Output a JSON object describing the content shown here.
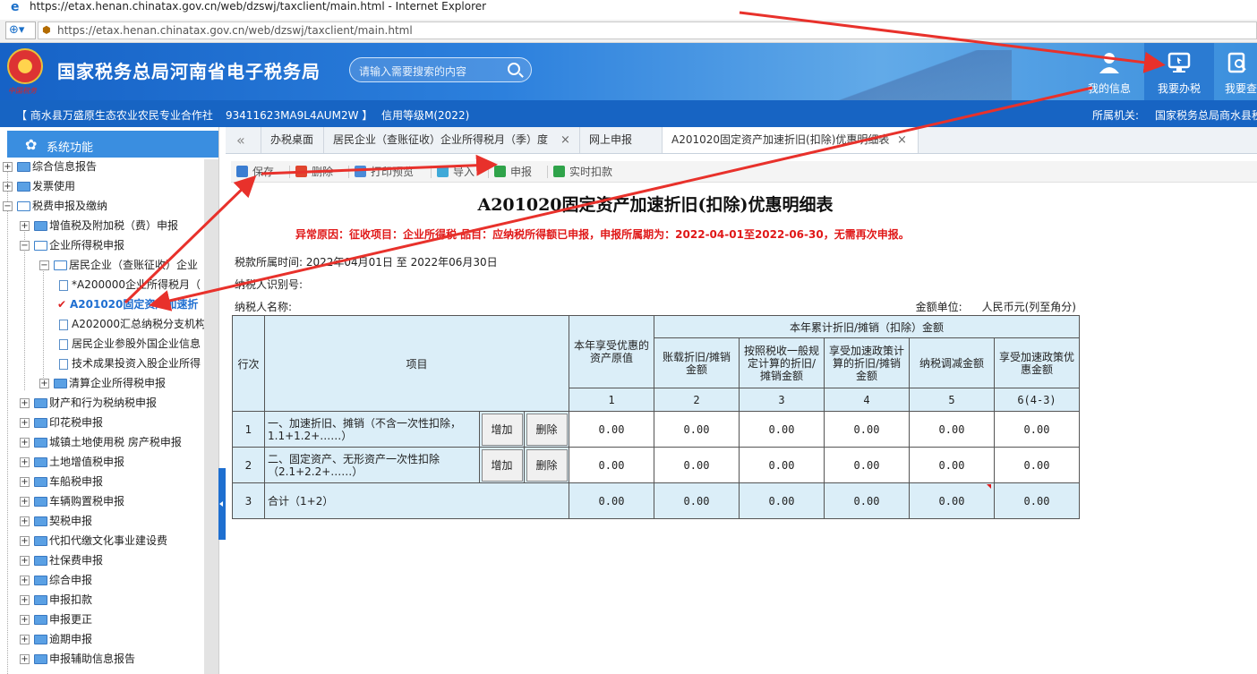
{
  "browser": {
    "window_title": "https://etax.henan.chinatax.gov.cn/web/dzswj/taxclient/main.html - Internet Explorer",
    "address": "https://etax.henan.chinatax.gov.cn/web/dzswj/taxclient/main.html"
  },
  "header": {
    "site_title": "国家税务总局河南省电子税务局",
    "emblem_caption": "中国税务",
    "search_placeholder": "请输入需要搜索的内容",
    "nav": [
      {
        "label": "我的信息",
        "icon": "user-icon"
      },
      {
        "label": "我要办税",
        "icon": "monitor-icon",
        "active": true
      },
      {
        "label": "我要查",
        "icon": "search-doc-icon"
      }
    ]
  },
  "company": {
    "name": "【 商水县万盛原生态农业农民专业合作社",
    "tax_id": "93411623MA9L4AUM2W 】",
    "credit": "信用等级M(2022)",
    "authority_label": "所属机关:",
    "authority": "国家税务总局商水县税"
  },
  "sidebar": {
    "title": "系统功能",
    "items": [
      {
        "label": "综合信息报告"
      },
      {
        "label": "发票使用"
      },
      {
        "label": "税费申报及缴纳"
      },
      {
        "label": "增值税及附加税（费）申报"
      },
      {
        "label": "企业所得税申报"
      },
      {
        "label": "居民企业（查账征收）企业"
      },
      {
        "label": "*A200000企业所得税月（"
      },
      {
        "label": "A201020固定资产加速折"
      },
      {
        "label": "A202000汇总纳税分支机构"
      },
      {
        "label": "居民企业参股外国企业信息"
      },
      {
        "label": "技术成果投资入股企业所得"
      },
      {
        "label": "清算企业所得税申报"
      },
      {
        "label": "财产和行为税纳税申报"
      },
      {
        "label": "印花税申报"
      },
      {
        "label": "城镇土地使用税 房产税申报"
      },
      {
        "label": "土地增值税申报"
      },
      {
        "label": "车船税申报"
      },
      {
        "label": "车辆购置税申报"
      },
      {
        "label": "契税申报"
      },
      {
        "label": "代扣代缴文化事业建设费"
      },
      {
        "label": "社保费申报"
      },
      {
        "label": "综合申报"
      },
      {
        "label": "申报扣款"
      },
      {
        "label": "申报更正"
      },
      {
        "label": "逾期申报"
      },
      {
        "label": "申报辅助信息报告"
      }
    ]
  },
  "tabs": {
    "back": "«",
    "items": [
      {
        "label": "办税桌面",
        "close": ""
      },
      {
        "label": "居民企业（查账征收）企业所得税月（季）度",
        "close": "×"
      },
      {
        "label": "网上申报",
        "close": ""
      },
      {
        "label": "A201020固定资产加速折旧(扣除)优惠明细表",
        "close": "×"
      }
    ]
  },
  "toolbar": {
    "save": "保存",
    "delete": "删除",
    "print": "打印预览",
    "import": "导入",
    "declare": "申报",
    "deduct": "实时扣款"
  },
  "form": {
    "title": "A201020固定资产加速折旧(扣除)优惠明细表",
    "warning": "异常原因：征收项目：企业所得税        品目：应纳税所得额已申报，申报所属期为：2022-04-01至2022-06-30，无需再次申报。",
    "period": "税款所属时间: 2022年04月01日 至 2022年06月30日",
    "taxpayer_id_label": "纳税人识别号:",
    "taxpayer_name_label": "纳税人名称:",
    "unit_label": "金额单位:",
    "unit_value": "人民币元(列至角分)",
    "headers": {
      "row_no": "行次",
      "item": "项目",
      "c1": "本年享受优惠的资产原值",
      "group": "本年累计折旧/摊销（扣除）金额",
      "c2": "账载折旧/摊销金额",
      "c3": "按照税收一般规定计算的折旧/摊销金额",
      "c4": "享受加速政策计算的折旧/摊销金额",
      "c5": "纳税调减金额",
      "c6": "享受加速政策优惠金额",
      "n1": "1",
      "n2": "2",
      "n3": "3",
      "n4": "4",
      "n5": "5",
      "n6": "6(4-3)"
    },
    "add_label": "增加",
    "del_label": "删除",
    "rows": [
      {
        "no": "1",
        "item": "一、加速折旧、摊销（不含一次性扣除，1.1+1.2+……）",
        "v1": "0.00",
        "v2": "0.00",
        "v3": "0.00",
        "v4": "0.00",
        "v5": "0.00",
        "v6": "0.00"
      },
      {
        "no": "2",
        "item": "二、固定资产、无形资产一次性扣除（2.1+2.2+……）",
        "v1": "0.00",
        "v2": "0.00",
        "v3": "0.00",
        "v4": "0.00",
        "v5": "0.00",
        "v6": "0.00"
      },
      {
        "no": "3",
        "item": "合计（1+2）",
        "v1": "0.00",
        "v2": "0.00",
        "v3": "0.00",
        "v4": "0.00",
        "v5": "0.00",
        "v6": "0.00"
      }
    ]
  },
  "colors": {
    "header_blue": "#1662c6",
    "company_bar": "#1764c3",
    "warning_red": "#e01818",
    "table_header": "#dbeef8",
    "annotation_red": "#e8312b"
  }
}
